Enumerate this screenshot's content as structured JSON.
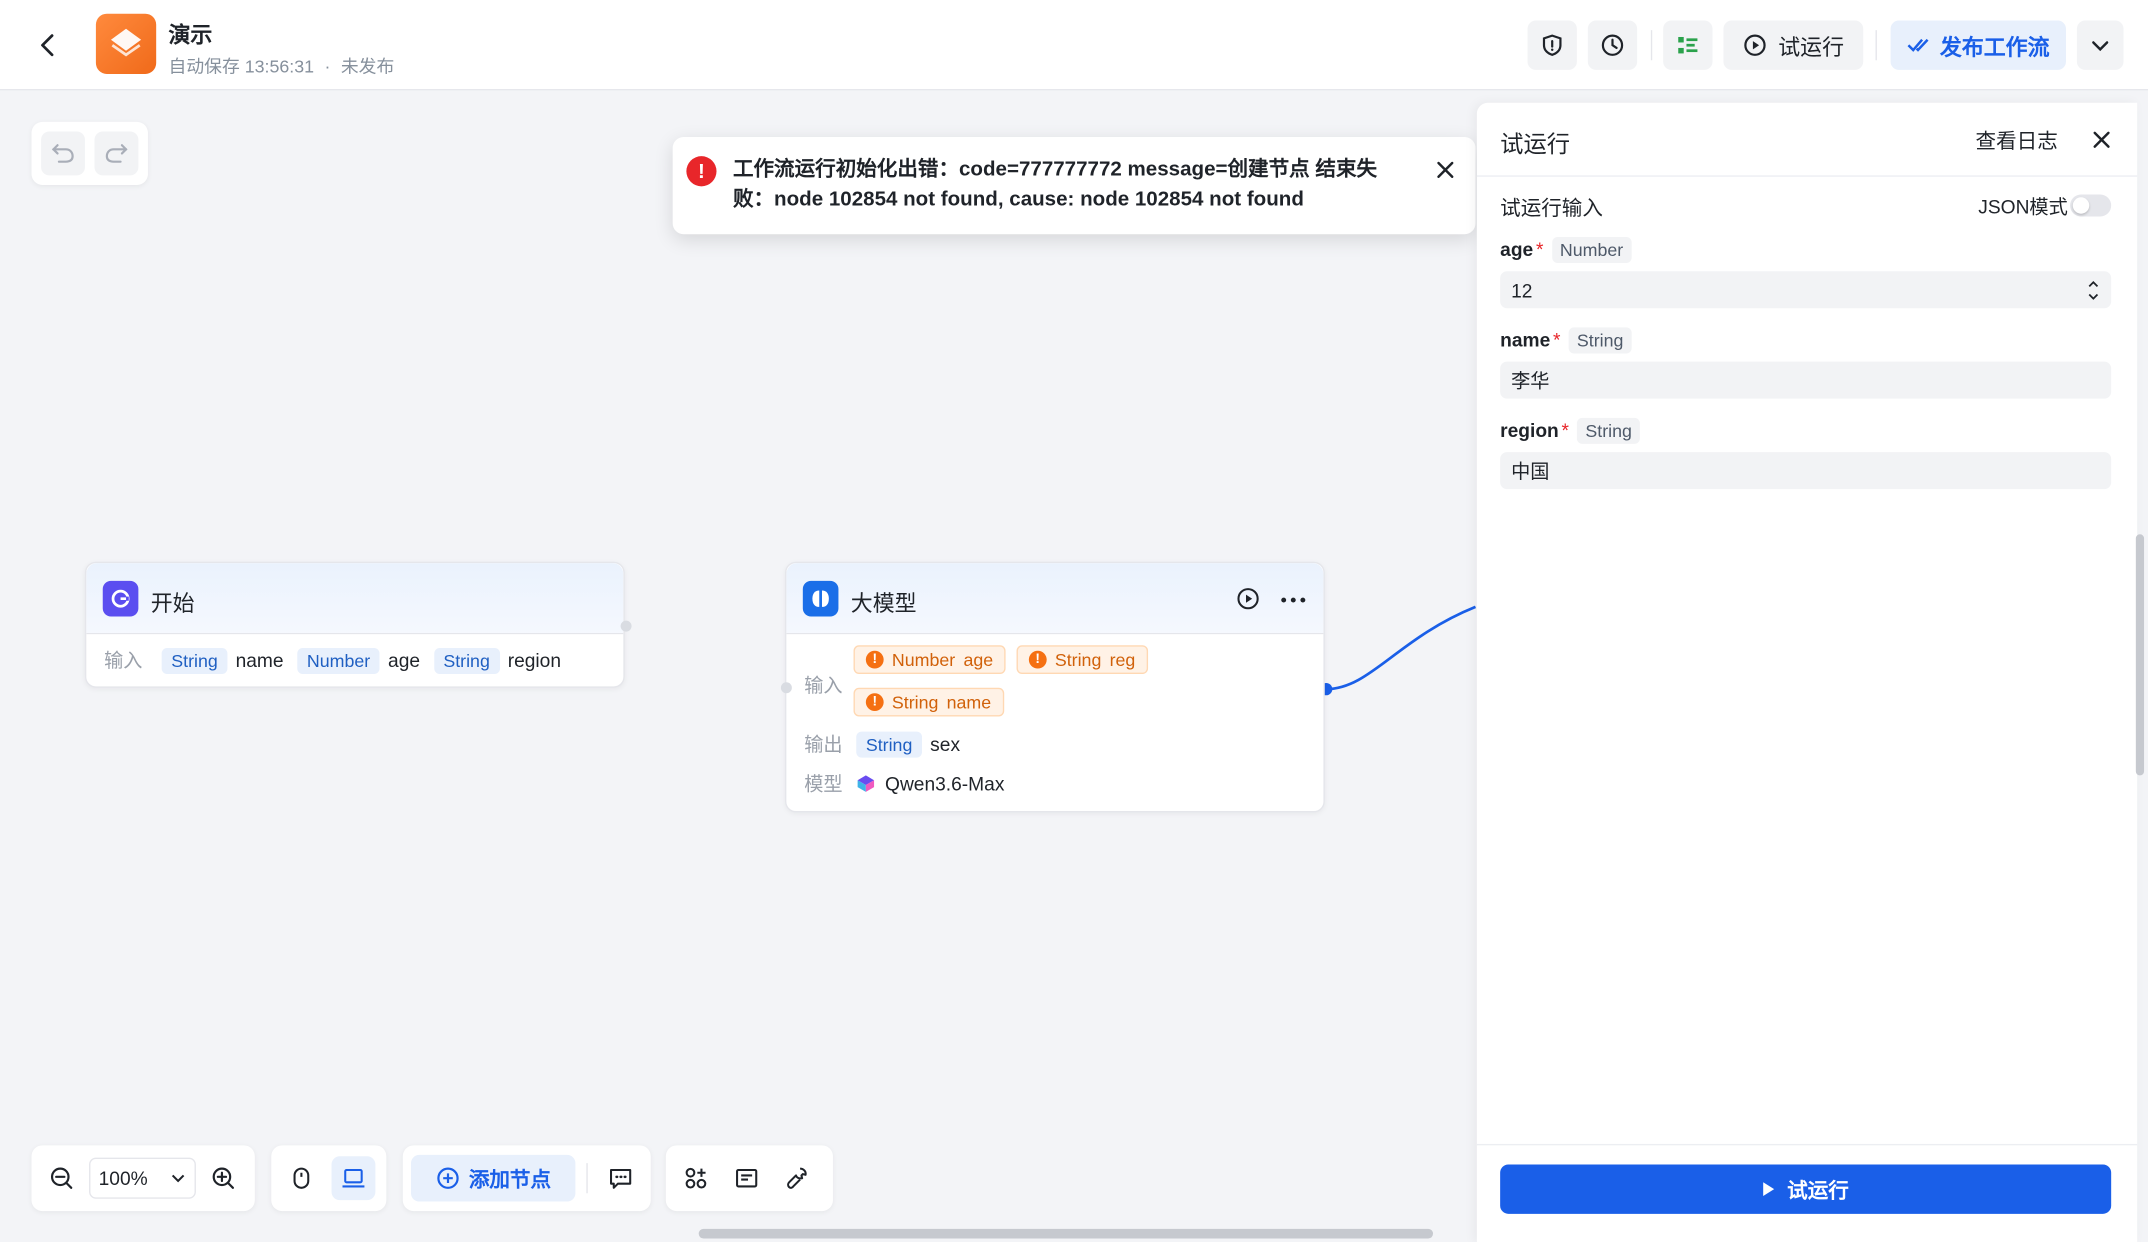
{
  "header": {
    "app_title": "演示",
    "autosave": "自动保存 13:56:31",
    "sep": "·",
    "status": "未发布",
    "test_run_label": "试运行",
    "publish_label": "发布工作流"
  },
  "toast": {
    "message": "工作流运行初始化出错：code=777777772 message=创建节点 结束失败：node 102854 not found, cause: node 102854 not found"
  },
  "start_node": {
    "title": "开始",
    "input_label": "输入",
    "params": [
      {
        "type": "String",
        "name": "name"
      },
      {
        "type": "Number",
        "name": "age"
      },
      {
        "type": "String",
        "name": "region"
      }
    ]
  },
  "llm_node": {
    "title": "大模型",
    "input_label": "输入",
    "inputs": [
      {
        "type": "Number",
        "name": "age"
      },
      {
        "type": "String",
        "name": "reg"
      },
      {
        "type": "String",
        "name": "name"
      }
    ],
    "output_label": "输出",
    "output": {
      "type": "String",
      "name": "sex"
    },
    "model_label": "模型",
    "model": "Qwen3.6-Max"
  },
  "toolbar": {
    "zoom": "100%",
    "add_node": "添加节点"
  },
  "panel": {
    "title": "试运行",
    "view_log": "查看日志",
    "section_title": "试运行输入",
    "json_mode": "JSON模式",
    "fields": [
      {
        "name": "age",
        "required": "*",
        "type": "Number",
        "value": "12"
      },
      {
        "name": "name",
        "required": "*",
        "type": "String",
        "value": "李华"
      },
      {
        "name": "region",
        "required": "*",
        "type": "String",
        "value": "中国"
      }
    ],
    "run_button": "试运行"
  },
  "colors": {
    "primary": "#1a5fe8",
    "error": "#e8262a",
    "warning": "#f57012",
    "app_icon": "#f06a1a"
  },
  "icons": [
    "back-arrow-icon",
    "shield-icon",
    "history-icon",
    "checklist-icon",
    "play-circle-icon",
    "double-check-icon",
    "chevron-down-icon",
    "undo-icon",
    "redo-icon",
    "error-icon",
    "close-icon",
    "start-node-icon",
    "llm-node-icon",
    "more-icon",
    "zoom-out-icon",
    "zoom-in-icon",
    "mouse-icon",
    "trackpad-icon",
    "plus-circle-icon",
    "comment-icon",
    "grid-icon",
    "note-icon",
    "wrench-icon",
    "play-icon"
  ]
}
